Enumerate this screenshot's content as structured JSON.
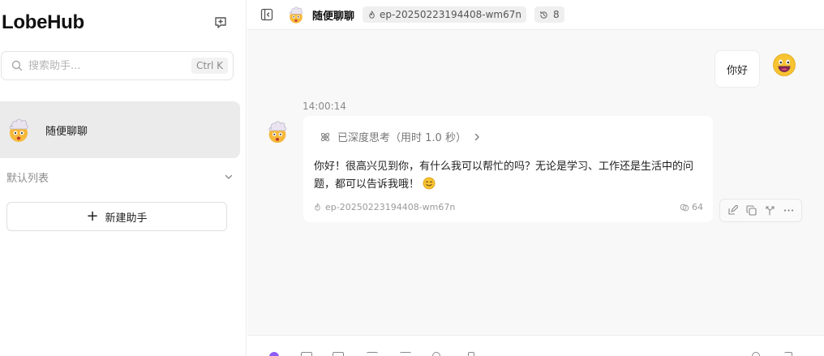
{
  "sidebar": {
    "brand": "LobeHub",
    "new_chat_icon": "message-plus-icon",
    "search": {
      "placeholder": "搜索助手...",
      "value": "",
      "shortcut": "Ctrl K",
      "icon": "search-icon"
    },
    "sessions": [
      {
        "label": "随便聊聊",
        "avatar": "exploding-head-emoji"
      }
    ],
    "group": {
      "label": "默认列表",
      "icon": "chevron-down-icon"
    },
    "add_assistant": {
      "label": "新建助手",
      "icon": "plus-icon"
    }
  },
  "header": {
    "panel_toggle_icon": "sidebar-collapse-icon",
    "title": "随便聊聊",
    "model": "ep-20250223194408-wm67n",
    "history_count": "8"
  },
  "messages": [
    {
      "role": "user",
      "text": "你好",
      "avatar": "grinning-face-emoji"
    },
    {
      "role": "assistant",
      "time": "14:00:14",
      "reasoning": "已深度思考（用时 1.0 秒）",
      "text": "你好！很高兴见到你，有什么我可以帮忙的吗？无论是学习、工作还是生活中的问题，都可以告诉我哦！",
      "model": "ep-20250223194408-wm67n",
      "tokens": "64"
    }
  ],
  "message_actions": [
    "edit-icon",
    "copy-icon",
    "branch-icon",
    "more-icon"
  ],
  "colors": {
    "accent": "#8b5cf6",
    "sidebar_bg": "#ffffff",
    "chat_bg": "#f8f8f8",
    "active_session": "#ebebeb"
  }
}
